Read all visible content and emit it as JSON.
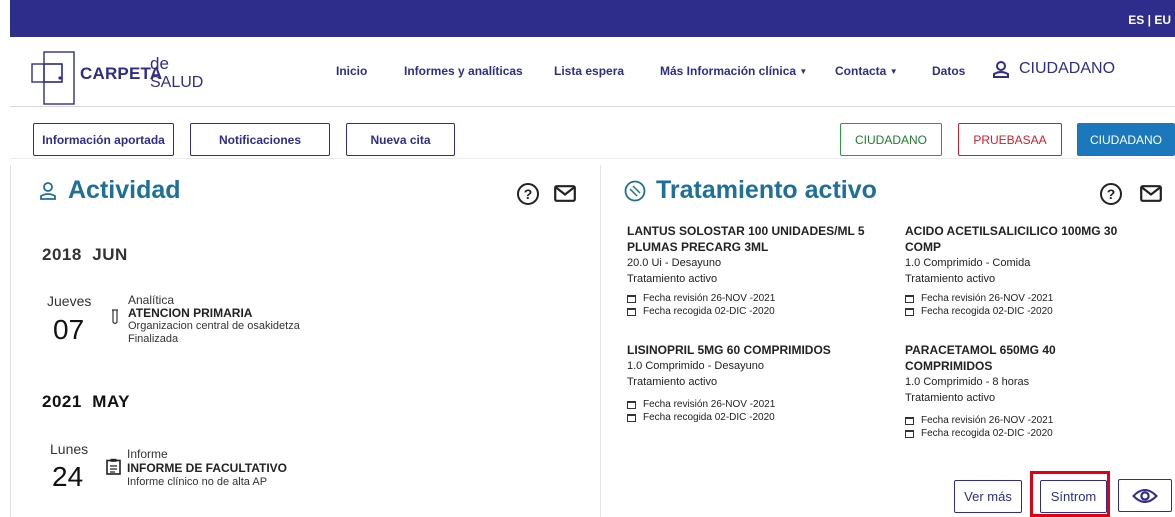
{
  "topbar": {
    "lang": "ES | EU"
  },
  "logo": {
    "carpeta": "CARPETA",
    "de": "de",
    "salud": "SALUD"
  },
  "nav": {
    "items": [
      {
        "label": "Inicio"
      },
      {
        "label": "Informes y analíticas"
      },
      {
        "label": "Lista espera"
      },
      {
        "label": "Más Información clínica"
      },
      {
        "label": "Contacta"
      },
      {
        "label": "Datos"
      }
    ],
    "user_label": "CIUDADANO"
  },
  "actions": {
    "informacion": "Información aportada",
    "notificaciones": "Notificaciones",
    "nueva_cita": "Nueva cita",
    "ciudadano_green": "CIUDADANO",
    "pruebasaa": "PRUEBASAA",
    "ciudadano_blue": "CIUDADANO"
  },
  "colors": {
    "brand": "#2e2d8c",
    "title": "#1e6f99",
    "green": "#2e9a3e",
    "red": "#d21d2b",
    "solid": "#1b78bd",
    "highlight": "#e00012"
  },
  "actividad": {
    "title": "Actividad",
    "groups": [
      {
        "year": "2018",
        "month": "JUN",
        "day_name": "Jueves",
        "day": "07",
        "type": "Analítica",
        "title": "ATENCION PRIMARIA",
        "line1": "Organizacion central de osakidetza",
        "line2": "Finalizada"
      },
      {
        "year": "2021",
        "month": "MAY",
        "day_name": "Lunes",
        "day": "24",
        "type": "Informe",
        "title": "INFORME DE FACULTATIVO",
        "line1": "Informe clínico no de alta AP"
      }
    ]
  },
  "tratamiento": {
    "title": "Tratamiento activo",
    "meds": [
      {
        "name1": "LANTUS SOLOSTAR 100 UNIDADES/ML 5",
        "name2": "PLUMAS PRECARG 3ML",
        "dose": "20.0 Ui - Desayuno",
        "status": "Tratamiento activo",
        "revision": "Fecha revisión 26-NOV -2021",
        "recogida": "Fecha recogida 02-DIC -2020"
      },
      {
        "name1": "ACIDO ACETILSALICILICO 100MG 30",
        "name2": "COMP",
        "dose": "1.0 Comprimido - Comida",
        "status": "Tratamiento activo",
        "revision": "Fecha revisión 26-NOV -2021",
        "recogida": "Fecha recogida 02-DIC -2020"
      },
      {
        "name1": "LISINOPRIL 5MG 60 COMPRIMIDOS",
        "dose": "1.0 Comprimido - Desayuno",
        "status": "Tratamiento activo",
        "revision": "Fecha revisión 26-NOV -2021",
        "recogida": "Fecha recogida 02-DIC -2020"
      },
      {
        "name1": "PARACETAMOL 650MG 40",
        "name2": "COMPRIMIDOS",
        "dose": "1.0 Comprimido - 8 horas",
        "status": "Tratamiento activo",
        "revision": "Fecha revisión 26-NOV -2021",
        "recogida": "Fecha recogida 02-DIC -2020"
      }
    ],
    "ver_mas": "Ver más",
    "sintrom": "Síntrom"
  },
  "icons": {
    "help": "question-circle-icon",
    "mail": "envelope-icon",
    "user": "user-icon",
    "pill": "pill-icon",
    "eye": "eye-icon",
    "flask": "test-tube-icon",
    "clipboard": "clipboard-icon",
    "calendar": "calendar-icon"
  }
}
